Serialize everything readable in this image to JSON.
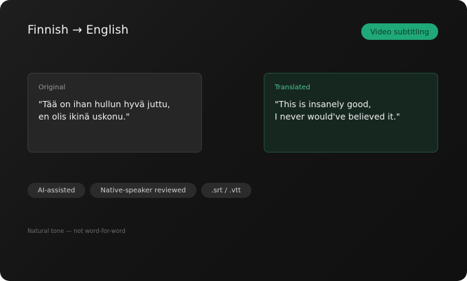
{
  "header": {
    "title": "Finnish → English",
    "badge": "Video subtitling"
  },
  "original": {
    "label": "Original",
    "text": "\"Tää on ihan hullun hyvä juttu,\nen olis ikinä uskonu.\""
  },
  "translated": {
    "label": "Translated",
    "text": "\"This is insanely good,\nI never would've believed it.\""
  },
  "chips": [
    "AI-assisted",
    "Native-speaker reviewed",
    ".srt / .vtt"
  ],
  "footnote": "Natural tone — not word-for-word",
  "colors": {
    "accent": "#1fa878",
    "translated_label": "#4fc48f",
    "background": "#141414"
  }
}
